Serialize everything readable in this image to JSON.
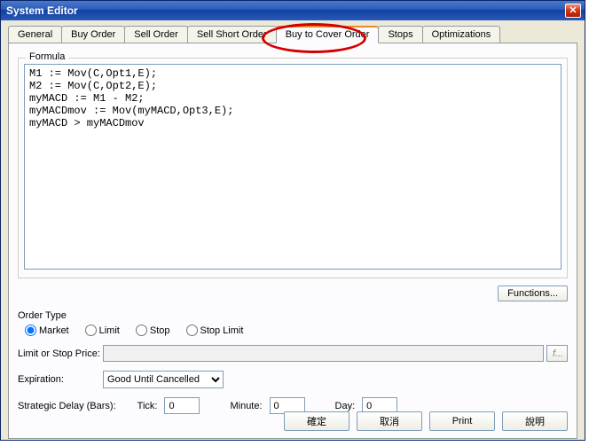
{
  "window": {
    "title": "System Editor",
    "close_glyph": "✕"
  },
  "tabs": [
    "General",
    "Buy Order",
    "Sell Order",
    "Sell Short Order",
    "Buy to Cover Order",
    "Stops",
    "Optimizations"
  ],
  "active_tab_index": 4,
  "formula": {
    "legend": "Formula",
    "text": "M1 := Mov(C,Opt1,E);\nM2 := Mov(C,Opt2,E);\nmyMACD := M1 - M2;\nmyMACDmov := Mov(myMACD,Opt3,E);\nmyMACD > myMACDmov"
  },
  "functions_btn": "Functions...",
  "order_type": {
    "legend": "Order Type",
    "options": [
      "Market",
      "Limit",
      "Stop",
      "Stop Limit"
    ],
    "selected_index": 0
  },
  "limit_stop": {
    "label": "Limit or Stop Price:",
    "value": "",
    "f_hint": "f..."
  },
  "expiration": {
    "label": "Expiration:",
    "selected": "Good Until Cancelled",
    "options": [
      "Good Until Cancelled"
    ]
  },
  "delay": {
    "label": "Strategic Delay (Bars):",
    "tick_label": "Tick:",
    "tick": "0",
    "minute_label": "Minute:",
    "minute": "0",
    "day_label": "Day:",
    "day": "0"
  },
  "buttons": {
    "ok": "確定",
    "cancel": "取消",
    "print": "Print",
    "help": "說明"
  }
}
